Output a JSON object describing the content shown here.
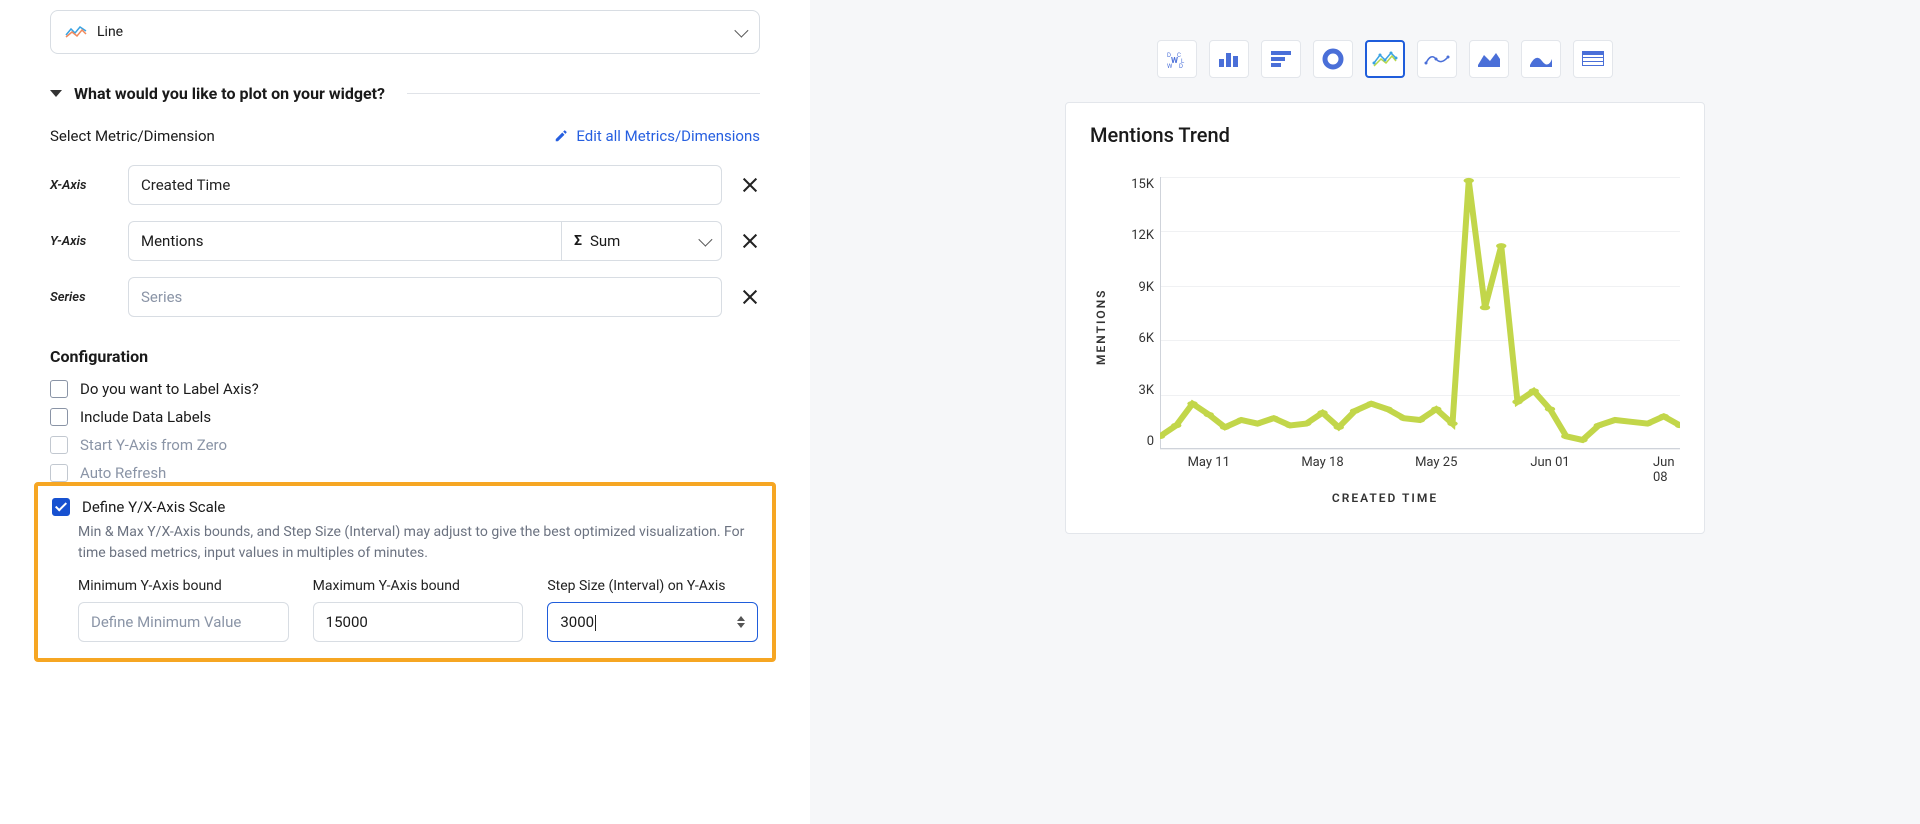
{
  "viz_select": {
    "label": "Line"
  },
  "plot_section": {
    "title": "What would you like to plot on your widget?",
    "select_label": "Select Metric/Dimension",
    "edit_link": "Edit all Metrics/Dimensions",
    "x_axis_label": "X-Axis",
    "x_axis_value": "Created Time",
    "y_axis_label": "Y-Axis",
    "y_axis_value": "Mentions",
    "y_agg_value": "Sum",
    "series_label": "Series",
    "series_placeholder": "Series"
  },
  "config": {
    "title": "Configuration",
    "label_axis": "Do you want to Label Axis?",
    "data_labels": "Include Data Labels",
    "y_from_zero": "Start Y-Axis from Zero",
    "auto_refresh": "Auto Refresh",
    "define_scale": "Define Y/X-Axis Scale",
    "hint": "Min & Max Y/X-Axis bounds, and Step Size (Interval) may adjust to give the best optimized visualization. For time based metrics, input values in multiples of minutes.",
    "min_label": "Minimum Y-Axis bound",
    "min_placeholder": "Define Minimum Value",
    "max_label": "Maximum Y-Axis bound",
    "max_value": "15000",
    "step_label": "Step Size (Interval) on Y-Axis",
    "step_value": "3000"
  },
  "chart": {
    "title": "Mentions Trend",
    "y_title": "MENTIONS",
    "x_title": "CREATED TIME"
  },
  "chart_data": {
    "type": "line",
    "title": "Mentions Trend",
    "xlabel": "CREATED TIME",
    "ylabel": "MENTIONS",
    "ylim": [
      0,
      15000
    ],
    "y_ticks": [
      "15K",
      "12K",
      "9K",
      "6K",
      "3K",
      "0"
    ],
    "x_ticks": [
      "May 11",
      "May 18",
      "May 25",
      "Jun 01",
      "Jun 08"
    ],
    "x": [
      "May 08",
      "May 09",
      "May 10",
      "May 11",
      "May 12",
      "May 13",
      "May 14",
      "May 15",
      "May 16",
      "May 17",
      "May 18",
      "May 19",
      "May 20",
      "May 21",
      "May 22",
      "May 23",
      "May 24",
      "May 25",
      "May 26",
      "May 27",
      "May 28",
      "May 29",
      "May 30",
      "May 31",
      "Jun 01",
      "Jun 02",
      "Jun 03",
      "Jun 04",
      "Jun 05",
      "Jun 06",
      "Jun 07",
      "Jun 08",
      "Jun 09"
    ],
    "values": [
      700,
      1300,
      2500,
      1900,
      1200,
      1600,
      1400,
      1700,
      1300,
      1400,
      2000,
      1200,
      2100,
      2500,
      2200,
      1700,
      1600,
      2200,
      1400,
      14800,
      7800,
      11200,
      2600,
      3200,
      2200,
      700,
      500,
      1300,
      1600,
      1500,
      1400,
      1800,
      1300
    ],
    "series_color": "#c2d64a"
  }
}
